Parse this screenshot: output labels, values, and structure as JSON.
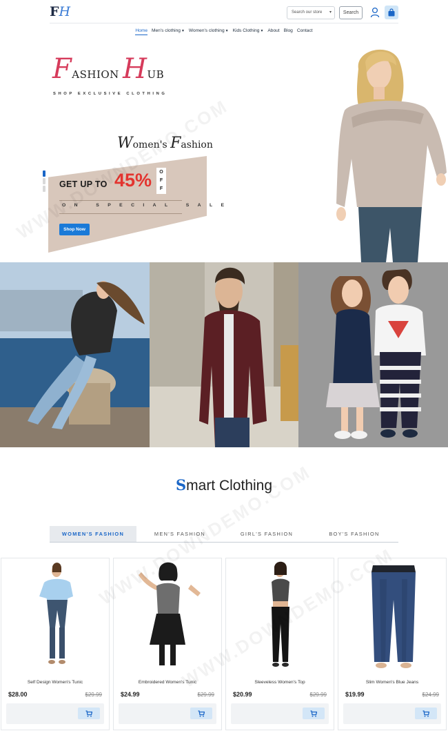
{
  "header": {
    "logo": {
      "letter1": "F",
      "letter2": "H"
    },
    "search_select": "Search our store",
    "search_button": "Search"
  },
  "nav": {
    "items": [
      {
        "label": "Home",
        "active": true,
        "dropdown": false
      },
      {
        "label": "Men's clothing",
        "active": false,
        "dropdown": true
      },
      {
        "label": "Women's clothing",
        "active": false,
        "dropdown": true
      },
      {
        "label": "Kids Clothing",
        "active": false,
        "dropdown": true
      },
      {
        "label": "About",
        "active": false,
        "dropdown": false
      },
      {
        "label": "Blog",
        "active": false,
        "dropdown": false
      },
      {
        "label": "Contact",
        "active": false,
        "dropdown": false
      }
    ]
  },
  "hero": {
    "brand_cap1": "F",
    "brand_rest1": "ASHION",
    "brand_cap2": "H",
    "brand_rest2": "UB",
    "brand_tagline": "SHOP EXCLUSIVE CLOTHING",
    "subtitle_cap1": "W",
    "subtitle_rest1": "omen's",
    "subtitle_cap2": "F",
    "subtitle_rest2": "ashion",
    "promo_get": "GET UP TO",
    "promo_percent": "45%",
    "promo_off": [
      "O",
      "F",
      "F"
    ],
    "promo_sale": "ON SPECIAL SALE",
    "shop_button": "Shop Now"
  },
  "section": {
    "title_cap": "S",
    "title_rest": "mart Clothing"
  },
  "tabs": [
    {
      "label": "WOMEN'S FASHION",
      "active": true
    },
    {
      "label": "MEN'S FASHION",
      "active": false
    },
    {
      "label": "GIRL'S FASHION",
      "active": false
    },
    {
      "label": "BOY'S FASHION",
      "active": false
    }
  ],
  "products": [
    {
      "name": "Self Design Women's Tunic",
      "price": "$28.00",
      "old_price": "$29.99"
    },
    {
      "name": "Embroidered Women's Tunic",
      "price": "$24.99",
      "old_price": "$29.99"
    },
    {
      "name": "Sleeveless Women's Top",
      "price": "$20.99",
      "old_price": "$29.99"
    },
    {
      "name": "Slim Women's Blue Jeans",
      "price": "$19.99",
      "old_price": "$24.99"
    }
  ],
  "colors": {
    "accent": "#1a66c7",
    "brand_red": "#d63b5b",
    "promo_red": "#e3342f",
    "promo_panel": "#d8c7bb"
  },
  "watermark": "WWW.DOWNDEMO.COM"
}
